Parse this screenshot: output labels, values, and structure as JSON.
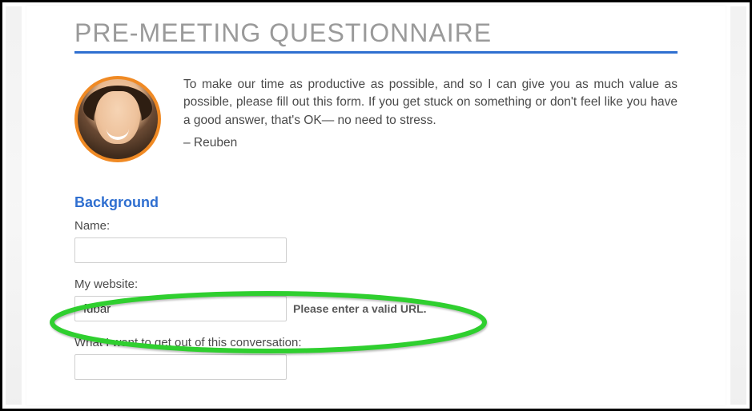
{
  "page": {
    "title": "PRE-MEETING QUESTIONNAIRE"
  },
  "intro": {
    "paragraph": "To make our time as productive as possible, and so I can give you as much value as possible, please fill out this form. If you get stuck on something or don't feel like you have a good answer, that's OK— no need to stress.",
    "signature": "– Reuben"
  },
  "section": {
    "heading": "Background"
  },
  "fields": {
    "name": {
      "label": "Name:",
      "value": ""
    },
    "website": {
      "label": "My website:",
      "value": "fubar",
      "error": "Please enter a valid URL."
    },
    "goal": {
      "label": "What I want to get out of this conversation:",
      "value": ""
    }
  }
}
